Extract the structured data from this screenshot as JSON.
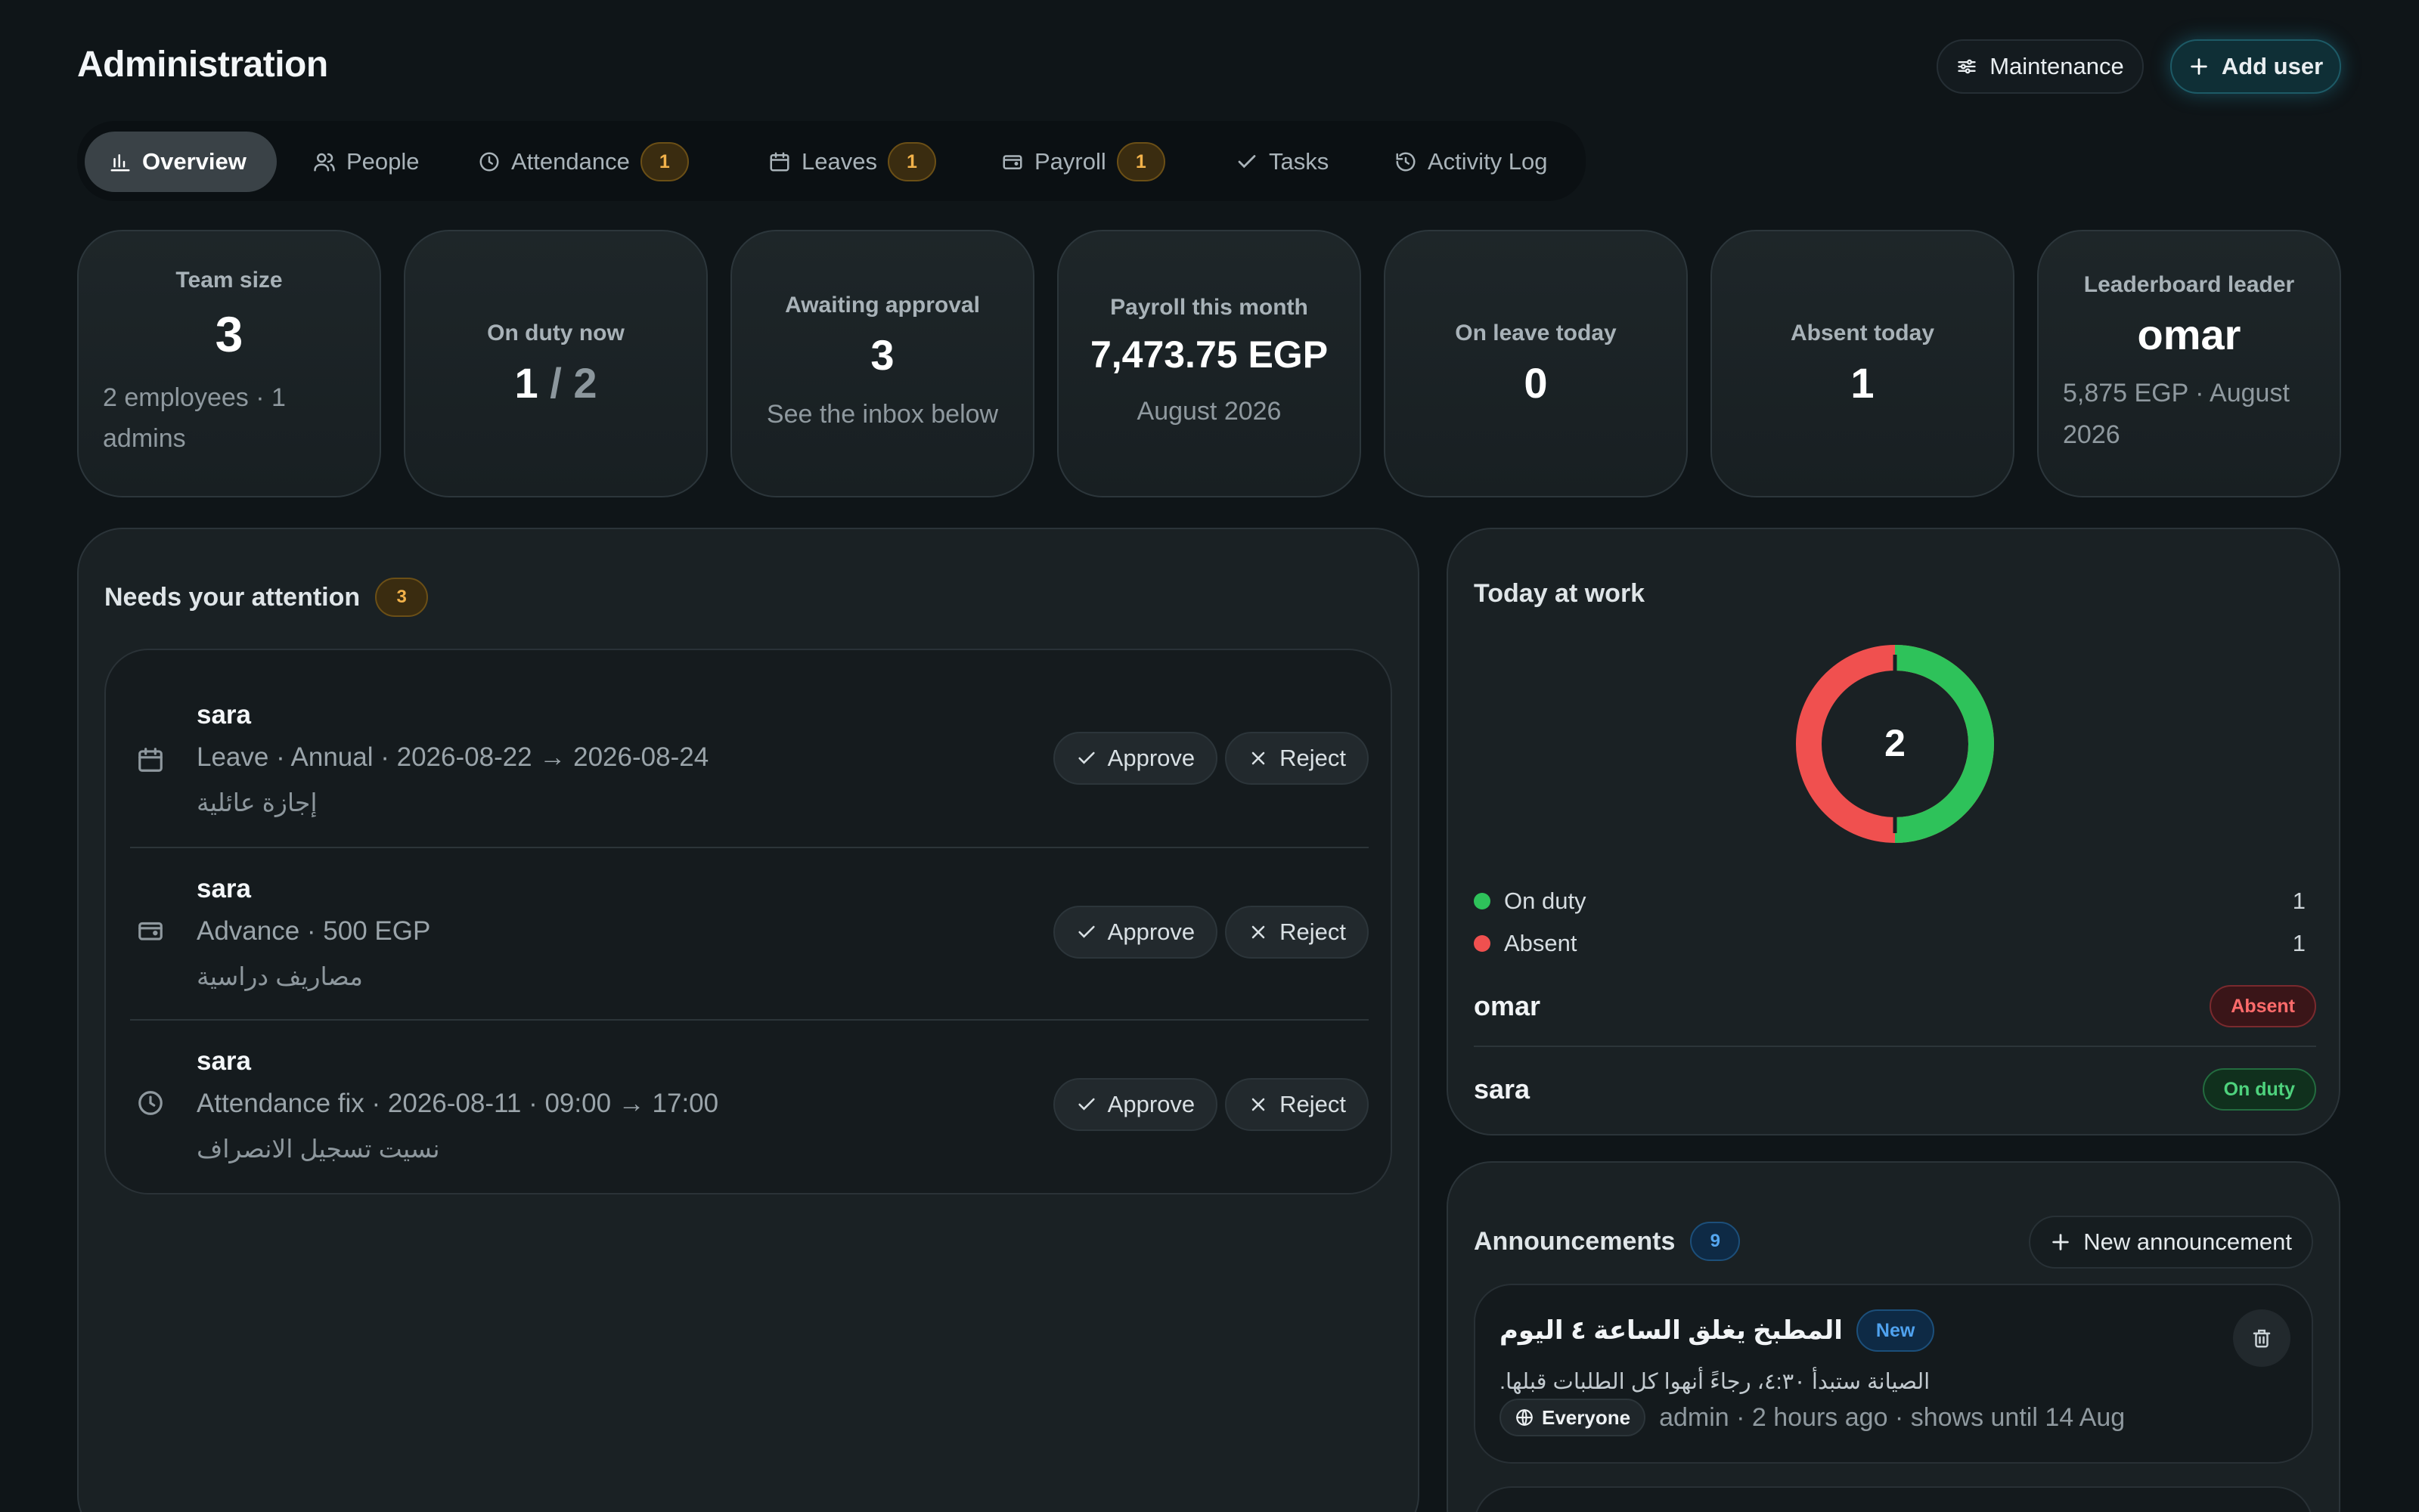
{
  "header": {
    "title": "Administration",
    "maintenance_label": "Maintenance",
    "add_user_label": "Add user"
  },
  "tabs": [
    {
      "label": "Overview",
      "icon": "bar-chart-icon",
      "badge": null,
      "active": true
    },
    {
      "label": "People",
      "icon": "users-icon",
      "badge": null
    },
    {
      "label": "Attendance",
      "icon": "clock-icon",
      "badge": "1"
    },
    {
      "label": "Leaves",
      "icon": "calendar-icon",
      "badge": "1"
    },
    {
      "label": "Payroll",
      "icon": "wallet-icon",
      "badge": "1"
    },
    {
      "label": "Tasks",
      "icon": "check-icon",
      "badge": null
    },
    {
      "label": "Activity Log",
      "icon": "history-icon",
      "badge": null
    }
  ],
  "stats": [
    {
      "label": "Team size",
      "value": "3",
      "sub": "2 employees · 1 admins"
    },
    {
      "label": "On duty now",
      "value_main": "1",
      "value_dim": "/ 2"
    },
    {
      "label": "Awaiting approval",
      "value": "3",
      "sub": "See the inbox below"
    },
    {
      "label": "Payroll this month",
      "value": "7,473.75 EGP",
      "sub": "August 2026"
    },
    {
      "label": "On leave today",
      "value": "0"
    },
    {
      "label": "Absent today",
      "value": "1"
    },
    {
      "label": "Leaderboard leader",
      "value": "omar",
      "sub": "5,875 EGP · August 2026"
    }
  ],
  "attention": {
    "title": "Needs your attention",
    "count": "3",
    "approve_label": "Approve",
    "reject_label": "Reject",
    "items": [
      {
        "icon": "calendar-icon",
        "name": "sara",
        "detail_a": "Leave · Annual · 2026-08-22",
        "arrow": "→",
        "detail_b": "2026-08-24",
        "note": "إجازة عائلية"
      },
      {
        "icon": "wallet-icon",
        "name": "sara",
        "detail_a": "Advance · 500 EGP",
        "arrow": "",
        "detail_b": "",
        "note": "مصاريف دراسية"
      },
      {
        "icon": "clock-icon",
        "name": "sara",
        "detail_a": "Attendance fix · 2026-08-11 · 09:00",
        "arrow": "→",
        "detail_b": "17:00",
        "note": "نسيت تسجيل الانصراف"
      }
    ]
  },
  "today": {
    "title": "Today at work",
    "total": "2",
    "legend": [
      {
        "label": "On duty",
        "value": "1",
        "color": "#2ec25a"
      },
      {
        "label": "Absent",
        "value": "1",
        "color": "#f0504f"
      }
    ],
    "people": [
      {
        "name": "omar",
        "status": "Absent"
      },
      {
        "name": "sara",
        "status": "On duty"
      }
    ]
  },
  "announcements": {
    "title": "Announcements",
    "count": "9",
    "new_label": "New announcement",
    "items": [
      {
        "title": "المطبخ يغلق الساعة ٤ اليوم",
        "new_badge": "New",
        "body": "الصيانة ستبدأ ٤:٣٠، رجاءً أنهوا كل الطلبات قبلها.",
        "audience": "Everyone",
        "meta": "admin · 2 hours ago · shows until 14 Aug"
      }
    ]
  },
  "colors": {
    "on_duty": "#2ec25a",
    "absent": "#f0504f",
    "badge_amber": "#f2b24a",
    "accent_blue": "#4fa2ef"
  }
}
